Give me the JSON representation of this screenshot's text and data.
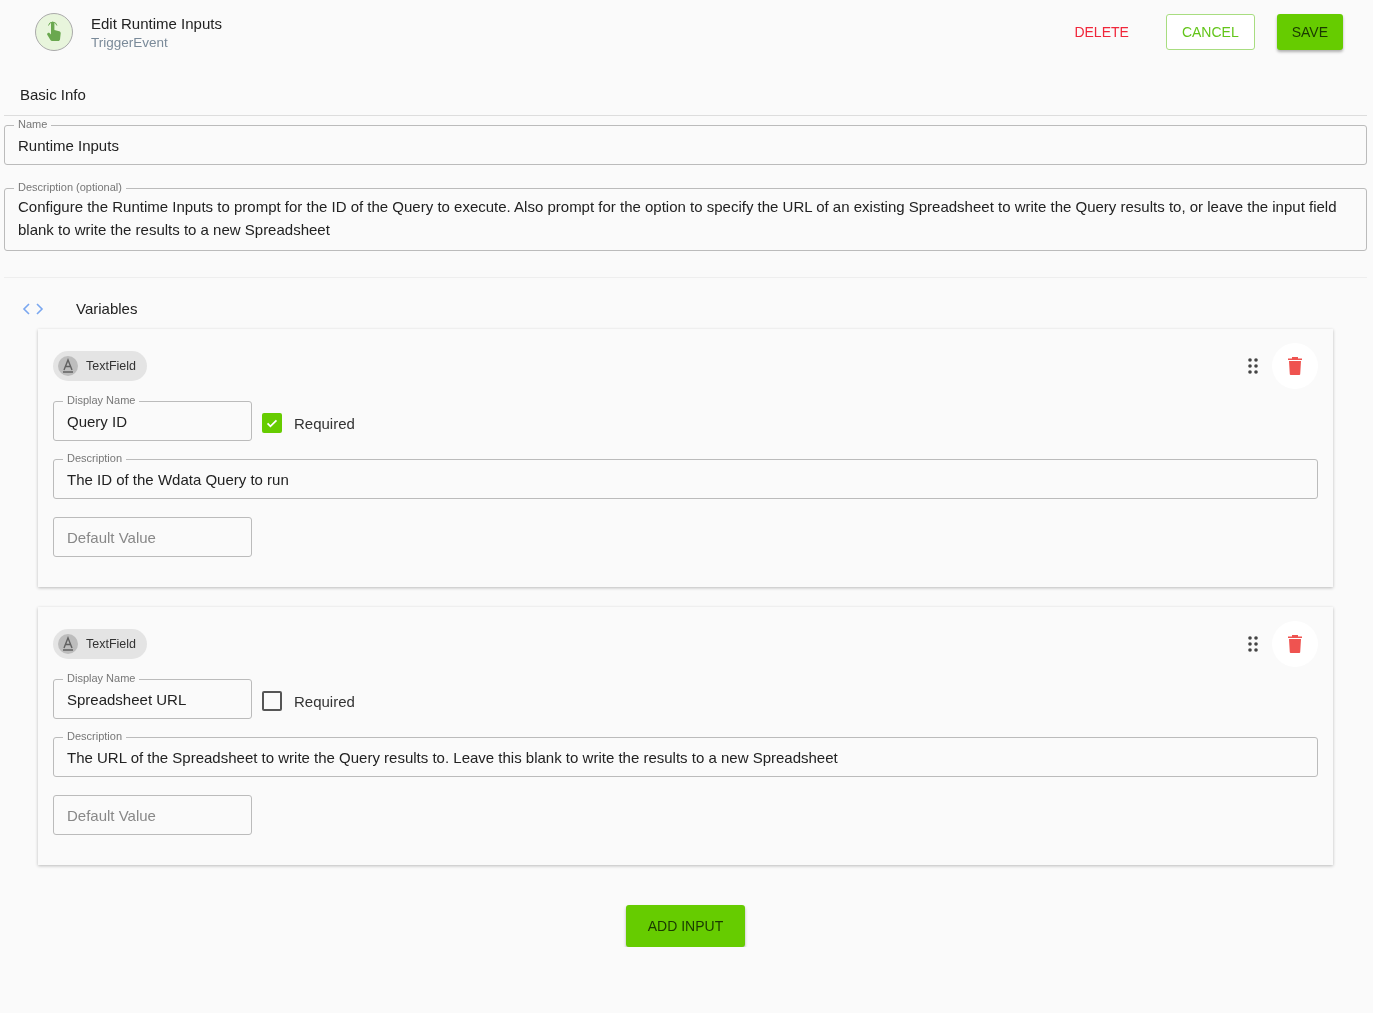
{
  "header": {
    "title": "Edit Runtime Inputs",
    "subtitle": "TriggerEvent",
    "buttons": [
      {
        "kind": "text",
        "label": "DELETE"
      },
      {
        "kind": "outlined",
        "label": "CANCEL"
      },
      {
        "kind": "filled",
        "label": "SAVE"
      }
    ]
  },
  "basic_info": {
    "heading": "Basic Info",
    "name": {
      "label": "Name",
      "value": "Runtime Inputs"
    },
    "description": {
      "label": "Description (optional)",
      "value": "Configure the Runtime Inputs to prompt for the ID of the Query to execute. Also prompt for the option to specify the URL of an existing Spreadsheet to write the Query results to, or leave the input field blank to write the results to a new Spreadsheet"
    }
  },
  "variables": {
    "heading": "Variables",
    "inputs": [
      {
        "type_chip": "TextField",
        "display_name": {
          "label": "Display Name",
          "value": "Query ID"
        },
        "required": {
          "label": "Required",
          "checked": true
        },
        "description": {
          "label": "Description",
          "value": "The ID of the Wdata Query to run"
        },
        "default_value": {
          "placeholder": "Default Value"
        }
      },
      {
        "type_chip": "TextField",
        "display_name": {
          "label": "Display Name",
          "value": "Spreadsheet URL"
        },
        "required": {
          "label": "Required",
          "checked": false
        },
        "description": {
          "label": "Description",
          "value": "The URL of the Spreadsheet to write the Query results to. Leave this blank to write the results to a new Spreadsheet"
        },
        "default_value": {
          "placeholder": "Default Value"
        }
      }
    ],
    "add_button": "ADD INPUT"
  }
}
